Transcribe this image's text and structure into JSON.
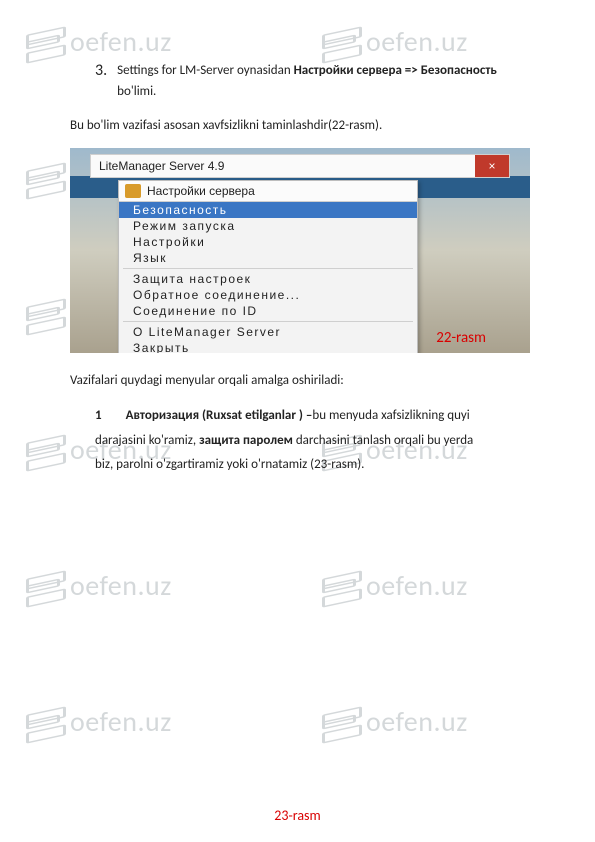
{
  "watermark_text": "oefen.uz",
  "line3_num": "3.",
  "line3_a": "Settings for LM-Server oynasidan ",
  "line3_b": "Настройки сервера => Безопасность",
  "line3_c1": "bo'limi.",
  "line_bu": "Bu bo'lim vazifasi asosan xavfsizlikni taminlashdir(22-rasm).",
  "app_title": "LiteManager Server 4.9",
  "close_glyph": "×",
  "menu_header": "Настройки сервера",
  "menu_items": [
    {
      "label": "Безопасность",
      "sel": true
    },
    {
      "label": "Режим запуска"
    },
    {
      "label": "Настройки"
    },
    {
      "label": "Язык"
    },
    {
      "sep": true
    },
    {
      "label": "Защита настроек"
    },
    {
      "label": "Обратное соединение..."
    },
    {
      "label": "Соединение по ID"
    },
    {
      "sep": true
    },
    {
      "label": "О LiteManager Server"
    },
    {
      "label": "Закрыть"
    }
  ],
  "fig22": "22-rasm",
  "vaz": "Vazifalari quydagi menyular orqali amalga oshiriladi:",
  "b1_num": "1",
  "b1_lead": "Авторизация (Ruxsat etilganlar ) –",
  "b1_t1": "bu  menyuda  xafsizlikning  quyi",
  "b1_line2a": "darajasini  ko'ramiz,  ",
  "b1_line2b": "защита паролем",
  "b1_line2c": "  darchasini tanlash orqali  bu yerda",
  "b1_line3": "biz,  parolni o'zgartiramiz  yoki o'rnatamiz (23-rasm).",
  "fig23": "23-rasm"
}
